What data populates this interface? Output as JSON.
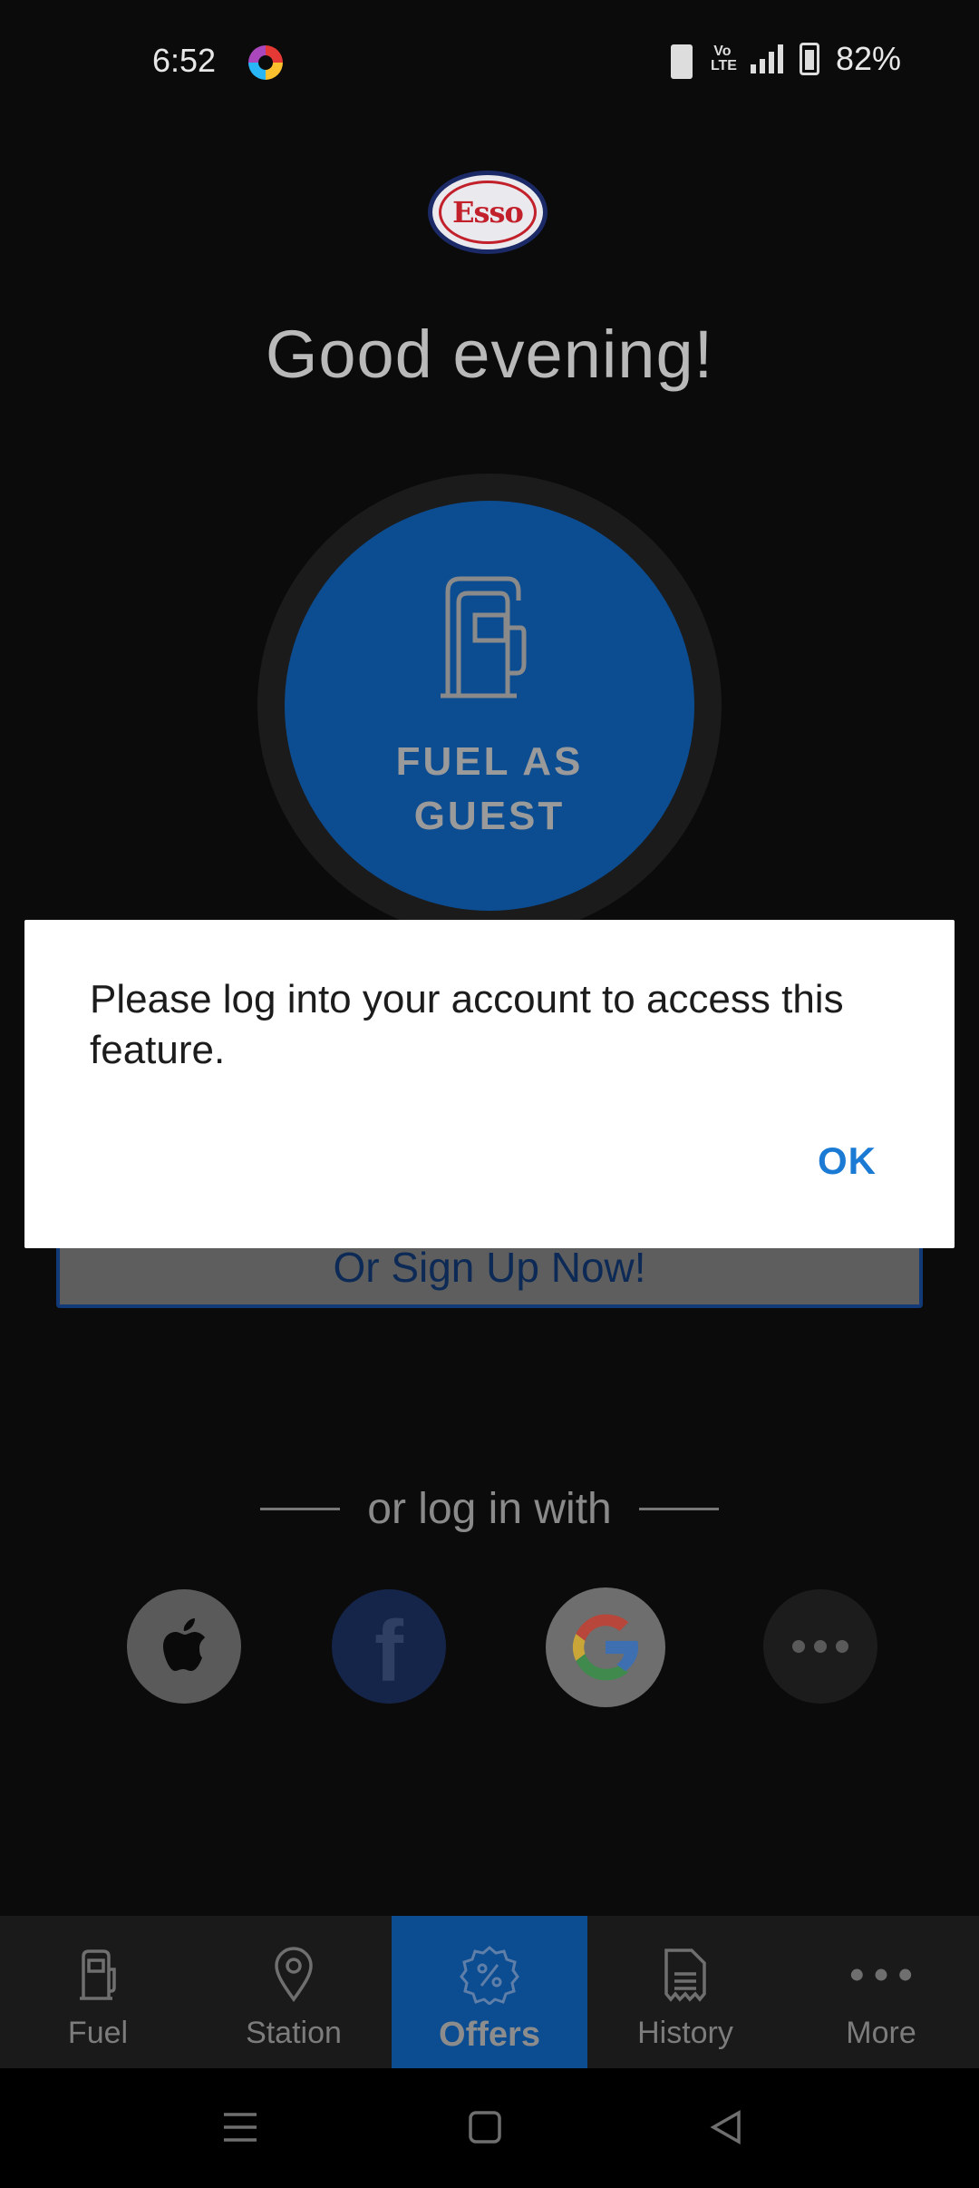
{
  "status_bar": {
    "time": "6:52",
    "network": "4G",
    "volte": "Vo LTE",
    "battery_percent": "82%"
  },
  "header": {
    "logo_text": "Esso",
    "greeting": "Good evening!"
  },
  "fuel_button": {
    "label": "FUEL AS GUEST",
    "icon": "fuel-pump-icon"
  },
  "signup": {
    "label": "Or Sign Up Now!"
  },
  "social_login": {
    "divider_text": "or log in with",
    "providers": [
      "apple",
      "facebook",
      "google",
      "more"
    ]
  },
  "dialog": {
    "message": "Please log into your account to access this feature.",
    "ok_label": "OK"
  },
  "bottom_nav": {
    "items": [
      {
        "label": "Fuel",
        "icon": "fuel-pump-icon"
      },
      {
        "label": "Station",
        "icon": "location-pin-icon"
      },
      {
        "label": "Offers",
        "icon": "offer-badge-icon",
        "active": true
      },
      {
        "label": "History",
        "icon": "receipt-icon"
      },
      {
        "label": "More",
        "icon": "more-dots-icon"
      }
    ]
  },
  "colors": {
    "brand_blue": "#0c4d92",
    "link_blue": "#1a7ad4",
    "esso_red": "#c2202a"
  }
}
